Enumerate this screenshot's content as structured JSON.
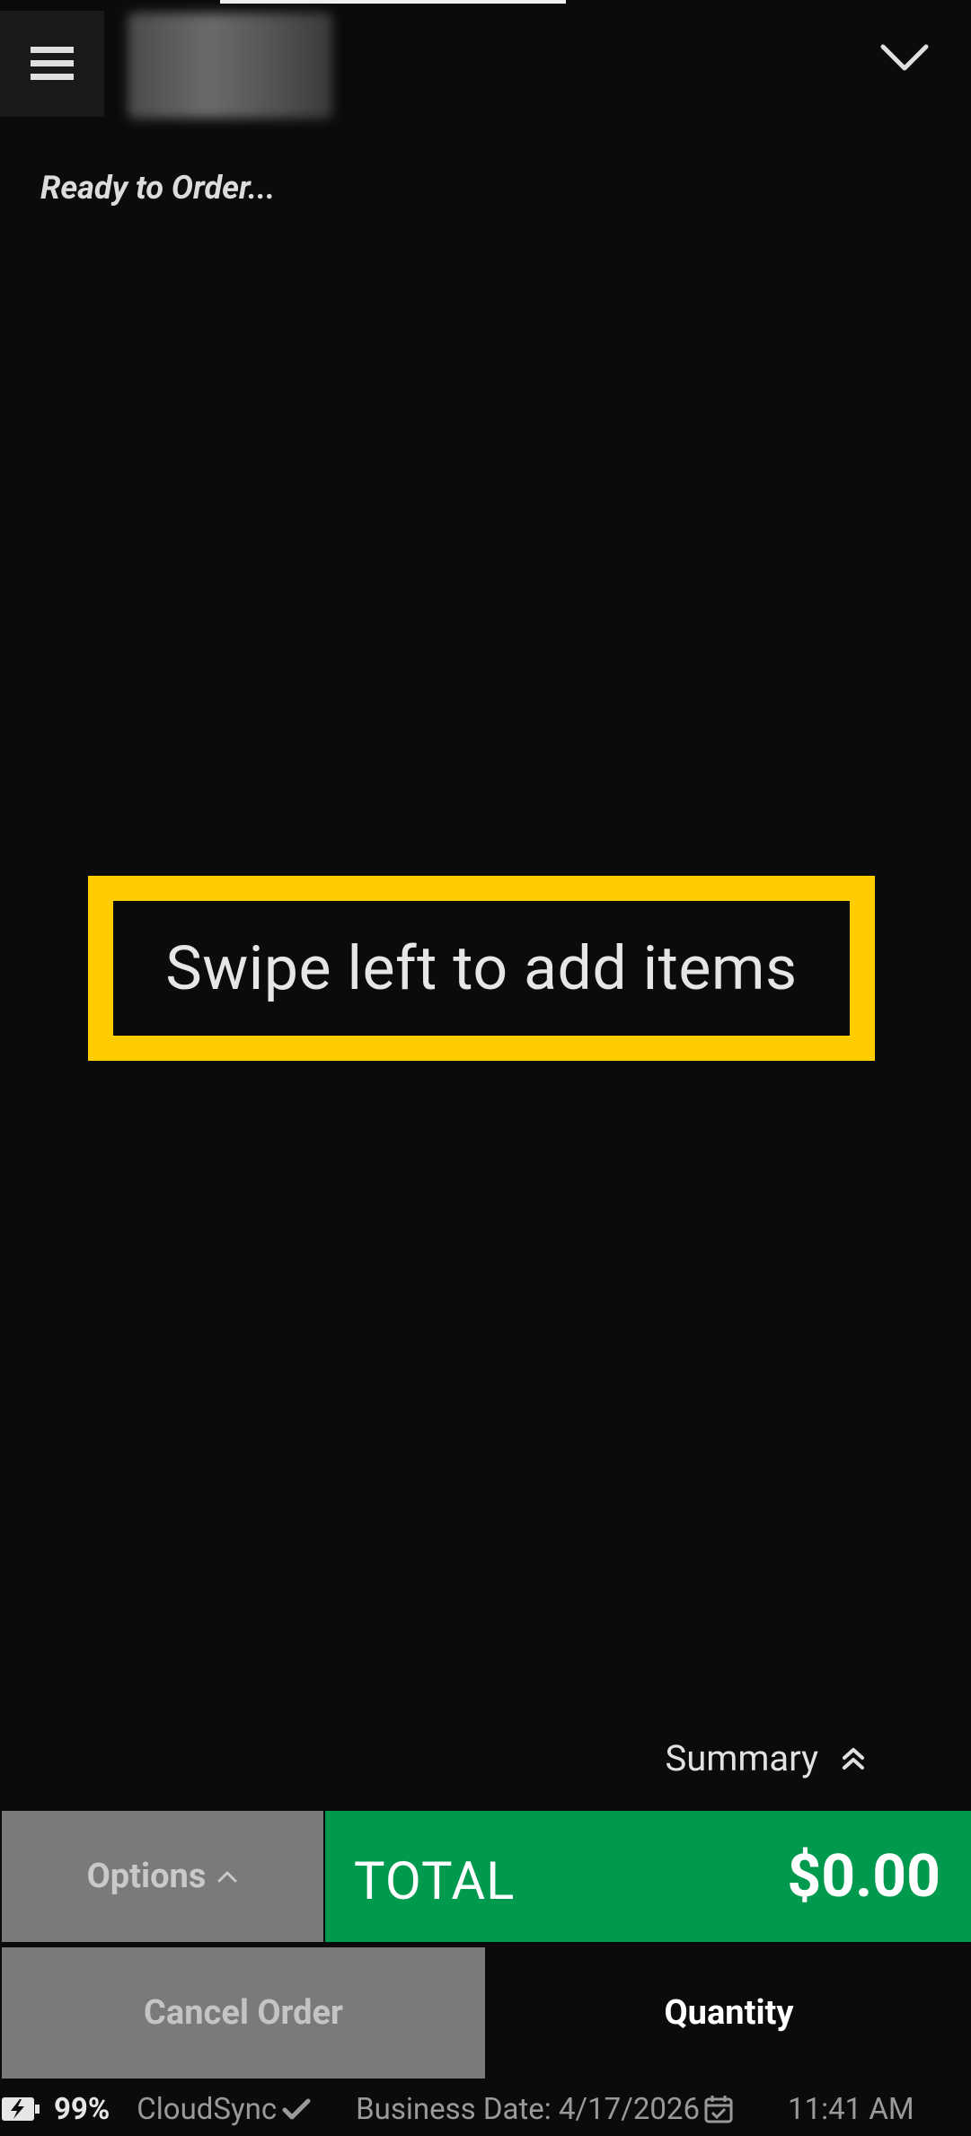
{
  "header": {
    "menu_icon": "hamburger-menu-icon",
    "expand_icon": "chevron-down-icon"
  },
  "order": {
    "status_text": "Ready to Order...",
    "empty_message": "Swipe left to add items"
  },
  "summary": {
    "label": "Summary",
    "icon": "double-chevron-up-icon"
  },
  "actions": {
    "options_label": "Options",
    "total_label": "TOTAL",
    "total_amount": "$0.00",
    "cancel_label": "Cancel Order",
    "quantity_label": "Quantity"
  },
  "status_bar": {
    "battery_percent": "99%",
    "sync_label": "CloudSync",
    "business_date": "Business Date: 4/17/2026",
    "time": "11:41 AM"
  },
  "colors": {
    "background": "#0b0b0b",
    "total_green": "#009a4e",
    "highlight_yellow": "#ffcc00",
    "button_gray": "#7a7a7a"
  }
}
